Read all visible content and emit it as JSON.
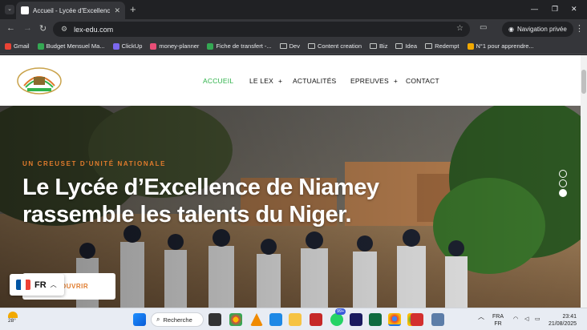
{
  "browser": {
    "tab_title": "Accueil - Lycée d'Excellence de",
    "url": "lex-edu.com",
    "incognito_label": "Navigation privée",
    "bookmarks": [
      {
        "label": "Gmail",
        "color": "#ea4335",
        "kind": "site"
      },
      {
        "label": "Budget Mensuel Ma...",
        "color": "#34a853",
        "kind": "site"
      },
      {
        "label": "ClickUp",
        "color": "#7b68ee",
        "kind": "site"
      },
      {
        "label": "money-planner",
        "color": "#e94e77",
        "kind": "site"
      },
      {
        "label": "Fiche de transfert -...",
        "color": "#34a853",
        "kind": "site"
      },
      {
        "label": "Dev",
        "kind": "folder"
      },
      {
        "label": "Content creation",
        "kind": "folder"
      },
      {
        "label": "Biz",
        "kind": "folder"
      },
      {
        "label": "Idea",
        "kind": "folder"
      },
      {
        "label": "Redempt",
        "kind": "folder"
      },
      {
        "label": "N°1 pour apprendre...",
        "color": "#f2a900",
        "kind": "site"
      }
    ]
  },
  "site": {
    "menu": [
      {
        "label": "ACCUEIL",
        "active": true,
        "dropdown": false
      },
      {
        "label": "LE LEX",
        "active": false,
        "dropdown": true
      },
      {
        "label": "ACTUALITÉS",
        "active": false,
        "dropdown": false
      },
      {
        "label": "EPREUVES",
        "active": false,
        "dropdown": true
      },
      {
        "label": "CONTACT",
        "active": false,
        "dropdown": false
      }
    ],
    "accent": "#2fb34a",
    "orange": "#e07b2c"
  },
  "hero": {
    "eyebrow": "UN CREUSET D'UNITÉ NATIONALE",
    "headline_line1": "Le Lycée d’Excellence de Niamey",
    "headline_line2": "rassemble les talents du Niger.",
    "cta_label": "OUVRIR",
    "slides": 3,
    "active_slide": 3
  },
  "language": {
    "code": "FR"
  },
  "taskbar": {
    "temperature": "28°",
    "search_label": "Recherche",
    "lang_top": "FRA",
    "lang_bottom": "FR",
    "time": "23:41",
    "date": "21/08/2025",
    "badge": "99+"
  }
}
